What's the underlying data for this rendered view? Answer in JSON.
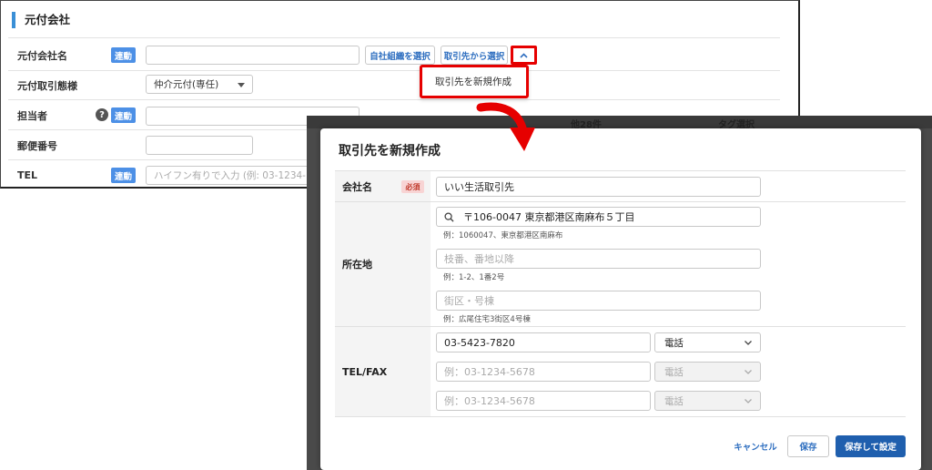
{
  "panel1": {
    "section_title": "元付会社",
    "rows": {
      "company": {
        "label": "元付会社名",
        "tag": "連動",
        "input_value": ""
      },
      "deal_type": {
        "label": "元付取引態様",
        "select_value": "仲介元付(専任)"
      },
      "staff": {
        "label": "担当者",
        "help": "?",
        "tag": "連動"
      },
      "postal": {
        "label": "郵便番号"
      },
      "tel": {
        "label": "TEL",
        "tag": "連動",
        "placeholder": "ハイフン有りで入力 (例: 03-1234-"
      }
    },
    "buttons": {
      "select_own_org": "自社組織を選択",
      "select_from_client": "取引先から選択"
    },
    "dropdown_item": "取引先を新規作成"
  },
  "backdrop": {
    "fragments": [
      "他28件",
      "タグ選択"
    ]
  },
  "modal": {
    "title": "取引先を新規作成",
    "company": {
      "label": "会社名",
      "required": "必須",
      "value": "いい生活取引先"
    },
    "address": {
      "label": "所在地",
      "search_value": "〒106-0047 東京都港区南麻布５丁目",
      "search_hint": "例：1060047、東京都港区南麻布",
      "street_placeholder": "枝番、番地以降",
      "street_hint": "例：1-2、1番2号",
      "building_placeholder": "街区・号棟",
      "building_hint": "例：広尾住宅3街区4号棟"
    },
    "telfax": {
      "label": "TEL/FAX",
      "rows": [
        {
          "value": "03-5423-7820",
          "placeholder": "",
          "type": "電話",
          "disabled": false
        },
        {
          "value": "",
          "placeholder": "例：03-1234-5678",
          "type": "電話",
          "disabled": true
        },
        {
          "value": "",
          "placeholder": "例：03-1234-5678",
          "type": "電話",
          "disabled": true
        }
      ]
    },
    "buttons": {
      "cancel": "キャンセル",
      "save": "保存",
      "save_and_set": "保存して設定"
    }
  },
  "colors": {
    "accent": "#3a8fd6",
    "tag_blue": "#4d90e6",
    "highlight_red": "#e60000",
    "primary_button": "#1f5fae"
  },
  "icons": {
    "help": "question-circle-icon",
    "chevron_up": "chevron-up-icon",
    "search": "search-icon",
    "arrow": "curved-arrow-icon",
    "select_caret": "chevron-down-icon"
  }
}
